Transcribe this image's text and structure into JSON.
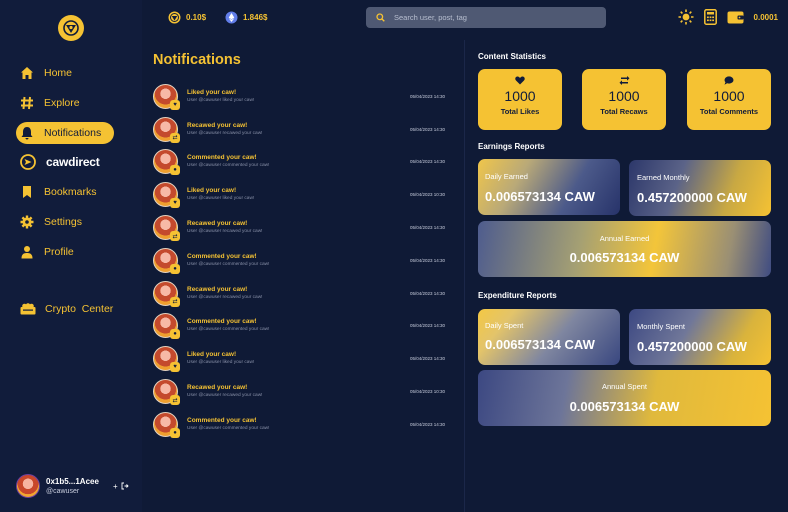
{
  "topbar": {
    "caw_price": "0.10$",
    "eth_price": "1.846$",
    "search_placeholder": "Search user, post, tag",
    "wallet_balance": "0.0001"
  },
  "sidebar": {
    "items": [
      {
        "label": "Home",
        "icon": "home-icon"
      },
      {
        "label": "Explore",
        "icon": "hash-icon"
      },
      {
        "label": "Notifications",
        "icon": "bell-icon",
        "active": true
      },
      {
        "label": "cawdirect",
        "icon": "cawdirect-icon"
      },
      {
        "label": "Bookmarks",
        "icon": "bookmark-icon"
      },
      {
        "label": "Settings",
        "icon": "gear-icon"
      },
      {
        "label": "Profile",
        "icon": "user-icon"
      }
    ],
    "crypto_center": "Crypto  Center",
    "user": {
      "address": "0x1b5...1Acee",
      "handle": "@cawuser",
      "add": "+"
    }
  },
  "notifications": {
    "title": "Notifications",
    "items": [
      {
        "title": "Liked your caw!",
        "desc": "User @cawuser liked your caw!",
        "time": "05/04/2023 14:30",
        "badge": "♥"
      },
      {
        "title": "Recawed your caw!",
        "desc": "User @cawuser recawed your caw!",
        "time": "05/04/2023 14:30",
        "badge": "⇄"
      },
      {
        "title": "Commented your caw!",
        "desc": "User @cawuser commented your caw!",
        "time": "05/04/2023 14:30",
        "badge": "●"
      },
      {
        "title": "Liked your caw!",
        "desc": "User @cawuser liked your caw!",
        "time": "05/04/2023 10:30",
        "badge": "♥"
      },
      {
        "title": "Recawed your caw!",
        "desc": "User @cawuser recawed your caw!",
        "time": "05/04/2023 14:30",
        "badge": "⇄"
      },
      {
        "title": "Commented your caw!",
        "desc": "User @cawuser commented your caw!",
        "time": "05/04/2023 14:30",
        "badge": "●"
      },
      {
        "title": "Recawed your caw!",
        "desc": "User @cawuser recawed your caw!",
        "time": "05/04/2023 14:30",
        "badge": "⇄"
      },
      {
        "title": "Commented your caw!",
        "desc": "User @cawuser commented your caw!",
        "time": "05/04/2023 14:30",
        "badge": "●"
      },
      {
        "title": "Liked your caw!",
        "desc": "User @cawuser liked your caw!",
        "time": "05/04/2023 14:30",
        "badge": "♥"
      },
      {
        "title": "Recawed your caw!",
        "desc": "User @cawuser recawed your caw!",
        "time": "05/04/2023 10:30",
        "badge": "⇄"
      },
      {
        "title": "Commented your caw!",
        "desc": "User @cawuser commented your caw!",
        "time": "05/04/2023 14:30",
        "badge": "●"
      }
    ]
  },
  "content_stats": {
    "heading": "Content Statistics",
    "likes": {
      "value": "1000",
      "label": "Total Likes"
    },
    "recaws": {
      "value": "1000",
      "label": "Total Recaws"
    },
    "comments": {
      "value": "1000",
      "label": "Total Comments"
    }
  },
  "earnings": {
    "heading": "Earnings Reports",
    "daily": {
      "label": "Daily Earned",
      "value": "0.006573134 CAW"
    },
    "monthly": {
      "label": "Earned Monthly",
      "value": "0.457200000 CAW"
    },
    "annual": {
      "label": "Annual Earned",
      "value": "0.006573134 CAW"
    }
  },
  "expenditure": {
    "heading": "Expenditure Reports",
    "daily": {
      "label": "Daily Spent",
      "value": "0.006573134 CAW"
    },
    "monthly": {
      "label": "Monthly Spent",
      "value": "0.457200000 CAW"
    },
    "annual": {
      "label": "Annual Spent",
      "value": "0.006573134 CAW"
    }
  },
  "colors": {
    "accent": "#f5c233",
    "background": "#0f1a36"
  }
}
